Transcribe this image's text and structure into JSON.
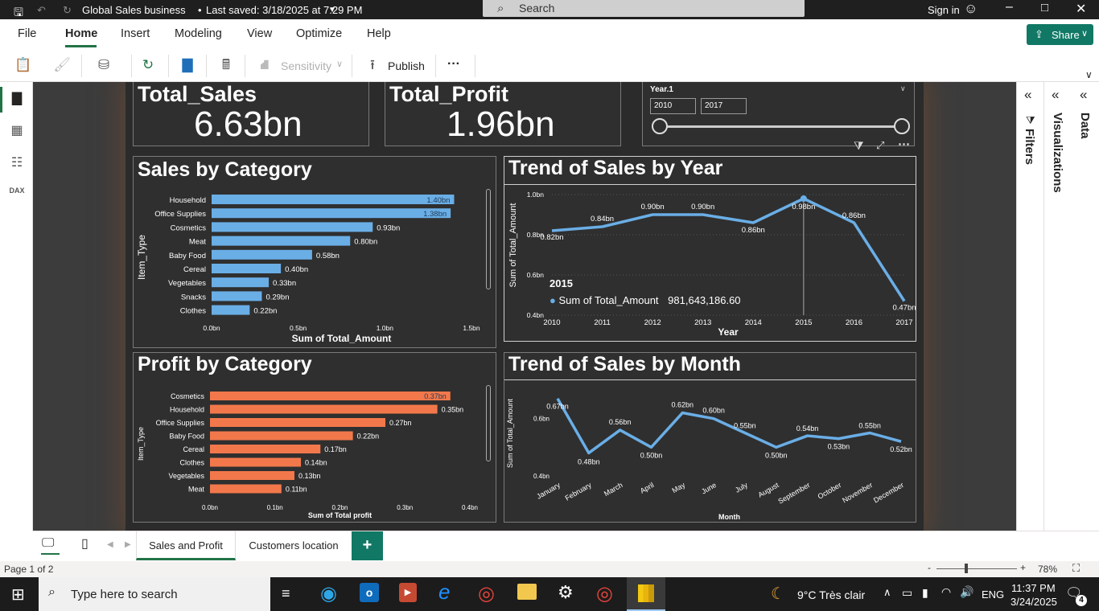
{
  "window": {
    "title": "Global Sales business",
    "saved_status": "Last saved: 3/18/2025 at 7:29 PM",
    "search_placeholder": "Search",
    "sign_in": "Sign in"
  },
  "menu": {
    "items": [
      "File",
      "Home",
      "Insert",
      "Modeling",
      "View",
      "Optimize",
      "Help"
    ],
    "active": "Home",
    "share": "Share"
  },
  "ribbon": {
    "sensitivity": "Sensitivity",
    "publish": "Publish",
    "more": "···"
  },
  "kpis": [
    {
      "title": "Total_Sales",
      "value": "6.63bn"
    },
    {
      "title": "Total_Profit",
      "value": "1.96bn"
    }
  ],
  "slicer": {
    "title": "Year.1",
    "from": "2010",
    "to": "2017"
  },
  "tabs": [
    "Sales and Profit",
    "Customers location"
  ],
  "status": {
    "page": "Page 1 of 2",
    "zoom": "78%"
  },
  "panes": {
    "filters": "Filters",
    "visualizations": "Visualizations",
    "data": "Data"
  },
  "taskbar": {
    "search_placeholder": "Type here to search",
    "weather": "9°C  Très clair",
    "lang": "ENG",
    "time": "11:37 PM",
    "date": "3/24/2025",
    "notifications": "4"
  },
  "colors": {
    "sales_bar": "#6aaee6",
    "profit_bar": "#f2784b",
    "line": "#6aaee6",
    "accent": "#217346"
  },
  "chart_data": [
    {
      "type": "bar",
      "title": "Sales by Category",
      "xlabel": "Sum of Total_Amount",
      "ylabel": "Item_Type",
      "categories": [
        "Household",
        "Office Supplies",
        "Cosmetics",
        "Meat",
        "Baby Food",
        "Cereal",
        "Vegetables",
        "Snacks",
        "Clothes"
      ],
      "values": [
        1.4,
        1.38,
        0.93,
        0.8,
        0.58,
        0.4,
        0.33,
        0.29,
        0.22
      ],
      "labels": [
        "1.40bn",
        "1.38bn",
        "0.93bn",
        "0.80bn",
        "0.58bn",
        "0.40bn",
        "0.33bn",
        "0.29bn",
        "0.22bn"
      ],
      "xticks": [
        "0.0bn",
        "0.5bn",
        "1.0bn",
        "1.5bn"
      ],
      "xlim": [
        0,
        1.5
      ]
    },
    {
      "type": "line",
      "title": "Trend of Sales by Year",
      "xlabel": "Year",
      "ylabel": "Sum of Total_Amount",
      "categories": [
        "2010",
        "2011",
        "2012",
        "2013",
        "2014",
        "2015",
        "2016",
        "2017"
      ],
      "values": [
        0.82,
        0.84,
        0.9,
        0.9,
        0.86,
        0.98,
        0.86,
        0.47
      ],
      "labels": [
        "0.82bn",
        "0.84bn",
        "0.90bn",
        "0.90bn",
        "0.86bn",
        "0.98bn",
        "0.86bn",
        "0.47bn"
      ],
      "yticks": [
        "1.0bn",
        "0.8bn",
        "0.6bn",
        "0.4bn"
      ],
      "ylim": [
        0.4,
        1.0
      ],
      "tooltip": {
        "header": "2015",
        "series": "Sum of Total_Amount",
        "value": "981,643,186.60"
      }
    },
    {
      "type": "bar",
      "title": "Profit by Category",
      "xlabel": "Sum of Total profit",
      "ylabel": "Item_Type",
      "categories": [
        "Cosmetics",
        "Household",
        "Office Supplies",
        "Baby Food",
        "Cereal",
        "Clothes",
        "Vegetables",
        "Meat"
      ],
      "values": [
        0.37,
        0.35,
        0.27,
        0.22,
        0.17,
        0.14,
        0.13,
        0.11
      ],
      "labels": [
        "0.37bn",
        "0.35bn",
        "0.27bn",
        "0.22bn",
        "0.17bn",
        "0.14bn",
        "0.13bn",
        "0.11bn"
      ],
      "xticks": [
        "0.0bn",
        "0.1bn",
        "0.2bn",
        "0.3bn",
        "0.4bn"
      ],
      "xlim": [
        0,
        0.4
      ]
    },
    {
      "type": "line",
      "title": "Trend of Sales by Month",
      "xlabel": "Month",
      "ylabel": "Sum of Total_Amount",
      "categories": [
        "January",
        "February",
        "March",
        "April",
        "May",
        "June",
        "July",
        "August",
        "September",
        "October",
        "November",
        "December"
      ],
      "values": [
        0.67,
        0.48,
        0.56,
        0.5,
        0.62,
        0.6,
        0.55,
        0.5,
        0.54,
        0.53,
        0.55,
        0.52
      ],
      "labels": [
        "0.67bn",
        "0.48bn",
        "0.56bn",
        "0.50bn",
        "0.62bn",
        "0.60bn",
        "0.55bn",
        "0.50bn",
        "0.54bn",
        "0.53bn",
        "0.55bn",
        "0.52bn"
      ],
      "yticks": [
        "0.6bn",
        "0.4bn"
      ],
      "ylim": [
        0.4,
        0.7
      ]
    }
  ]
}
